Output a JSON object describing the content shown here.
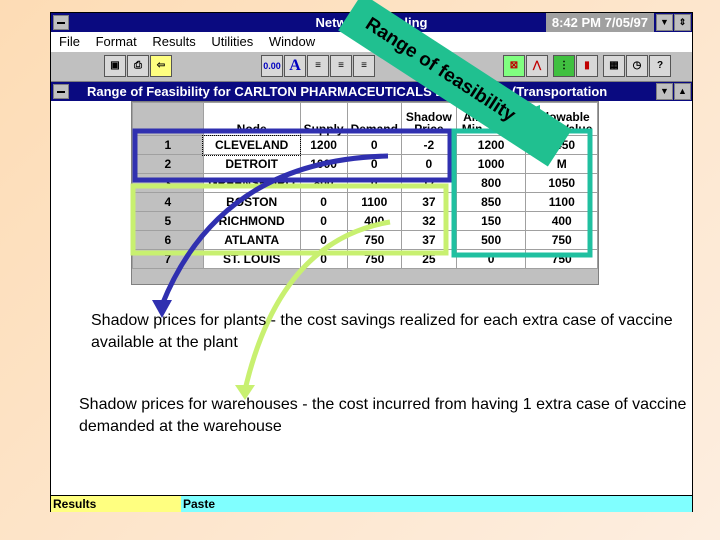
{
  "window": {
    "title": "Network Modeling",
    "clock": "8:42 PM  7/05/97"
  },
  "menu": [
    "File",
    "Format",
    "Results",
    "Utilities",
    "Window"
  ],
  "toolbar": {
    "number_format": "0.00",
    "font": "A"
  },
  "subwindow": {
    "title": "Range of Feasibility for CARLTON PHARMACEUTICALS Distribution (Transportation"
  },
  "table": {
    "headers": [
      "",
      "Node",
      "Supply",
      "Demand",
      "Shadow Price",
      "Allowable Min. Value",
      "Allowable Max. Value"
    ],
    "rows": [
      [
        "1",
        "CLEVELAND",
        "1200",
        "0",
        "-2",
        "1200",
        "1450"
      ],
      [
        "2",
        "DETROIT",
        "1000",
        "0",
        "0",
        "1000",
        "M"
      ],
      [
        "3",
        "GREENSBORO",
        "800",
        "0",
        "17",
        "800",
        "1050"
      ],
      [
        "4",
        "BOSTON",
        "0",
        "1100",
        "37",
        "850",
        "1100"
      ],
      [
        "5",
        "RICHMOND",
        "0",
        "400",
        "32",
        "150",
        "400"
      ],
      [
        "6",
        "ATLANTA",
        "0",
        "750",
        "37",
        "500",
        "750"
      ],
      [
        "7",
        "ST. LOUIS",
        "0",
        "750",
        "25",
        "0",
        "750"
      ]
    ]
  },
  "annotations": {
    "banner": "Range of feasibility",
    "plants_note_1": "Shadow prices for plants - the cost savings realized for each extra case of vaccine",
    "plants_note_2": "available at the plant",
    "warehouses_note_1": "Shadow prices for warehouses - the cost incurred from having 1 extra case of vaccine",
    "warehouses_note_2": "demanded at the warehouse",
    "colors": {
      "plants": "#3030b0",
      "warehouses": "#c8f070",
      "range": "#20c0a0"
    }
  },
  "status": {
    "left": "Results",
    "right": "Paste"
  }
}
